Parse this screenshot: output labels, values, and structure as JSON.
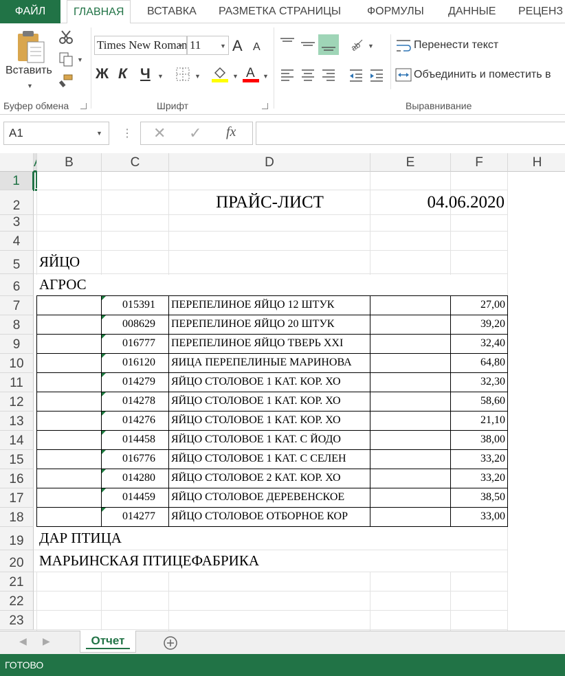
{
  "ribbon_tabs": [
    "ФАЙЛ",
    "ГЛАВНАЯ",
    "ВСТАВКА",
    "РАЗМЕТКА СТРАНИЦЫ",
    "ФОРМУЛЫ",
    "ДАННЫЕ",
    "РЕЦЕНЗ"
  ],
  "clipboard": {
    "paste_label": "Вставить",
    "group_label": "Буфер обмена"
  },
  "font": {
    "name": "Times New Roman",
    "size": "11",
    "group_label": "Шрифт",
    "bold": "Ж",
    "italic": "К",
    "underline": "Ч",
    "grow": "A",
    "shrink": "A"
  },
  "alignment": {
    "wrap_text": "Перенести текст",
    "merge": "Объединить и поместить в",
    "group_label": "Выравнивание"
  },
  "formula_bar": {
    "name_box": "A1",
    "fx": "fx",
    "value": ""
  },
  "columns": [
    "A",
    "B",
    "C",
    "D",
    "E",
    "F",
    "H"
  ],
  "rows": [
    "1",
    "2",
    "3",
    "4",
    "5",
    "6",
    "7",
    "8",
    "9",
    "10",
    "11",
    "12",
    "13",
    "14",
    "15",
    "16",
    "17",
    "18",
    "19",
    "20",
    "21",
    "22",
    "23"
  ],
  "sheet": {
    "title": "ПРАЙС-ЛИСТ",
    "date": "04.06.2020",
    "category": "ЯЙЦО",
    "supplier_1": "АГРОС",
    "supplier_2": "ДАР ПТИЦА",
    "supplier_3": "МАРЬИНСКАЯ ПТИЦЕФАБРИКА",
    "items": [
      {
        "code": "015391",
        "name": "ПЕРЕПЕЛИНОЕ ЯЙЦО 12 ШТУК",
        "price": "27,00"
      },
      {
        "code": "008629",
        "name": "ПЕРЕПЕЛИНОЕ ЯЙЦО 20 ШТУК",
        "price": "39,20"
      },
      {
        "code": "016777",
        "name": "ПЕРЕПЕЛИНОЕ ЯЙЦО ТВЕРЬ XXI",
        "price": "32,40"
      },
      {
        "code": "016120",
        "name": "ЯИЦА ПЕРЕПЕЛИНЫЕ МАРИНОВА",
        "price": "64,80"
      },
      {
        "code": "014279",
        "name": "ЯЙЦО СТОЛОВОЕ 1 КАТ. КОР. ХО",
        "price": "32,30"
      },
      {
        "code": "014278",
        "name": "ЯЙЦО СТОЛОВОЕ 1 КАТ. КОР. ХО",
        "price": "58,60"
      },
      {
        "code": "014276",
        "name": "ЯЙЦО СТОЛОВОЕ 1 КАТ. КОР. ХО",
        "price": "21,10"
      },
      {
        "code": "014458",
        "name": "ЯЙЦО СТОЛОВОЕ 1 КАТ. С ЙОДО",
        "price": "38,00"
      },
      {
        "code": "016776",
        "name": "ЯЙЦО СТОЛОВОЕ 1 КАТ. С СЕЛЕН",
        "price": "33,20"
      },
      {
        "code": "014280",
        "name": "ЯЙЦО СТОЛОВОЕ 2 КАТ. КОР. ХО",
        "price": "33,20"
      },
      {
        "code": "014459",
        "name": "ЯЙЦО СТОЛОВОЕ ДЕРЕВЕНСКОЕ",
        "price": "38,50"
      },
      {
        "code": "014277",
        "name": "ЯЙЦО СТОЛОВОЕ ОТБОРНОЕ КОР",
        "price": "33,00"
      }
    ]
  },
  "sheet_tab": "Отчет",
  "status": "ГОТОВО",
  "colors": {
    "accent": "#217346",
    "font_highlight": "#ffff00",
    "font_color": "#ff0000"
  }
}
